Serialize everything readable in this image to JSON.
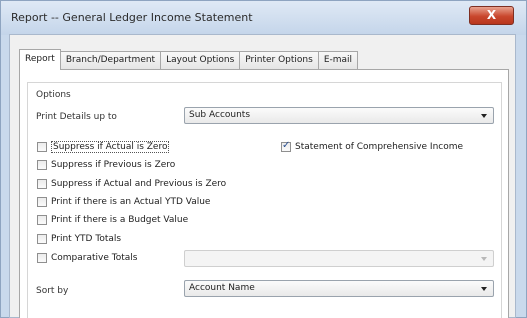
{
  "window": {
    "title": "Report -- General Ledger Income Statement",
    "close_label": "X"
  },
  "tabs": [
    {
      "label": "Report",
      "active": true
    },
    {
      "label": "Branch/Department",
      "active": false
    },
    {
      "label": "Layout Options",
      "active": false
    },
    {
      "label": "Printer Options",
      "active": false
    },
    {
      "label": "E-mail",
      "active": false
    }
  ],
  "options": {
    "group_label": "Options",
    "print_details_label": "Print Details up to",
    "print_details_value": "Sub Accounts",
    "checkboxes": [
      {
        "label": "Suppress if Actual is Zero",
        "checked": false
      },
      {
        "label": "Suppress if Previous is Zero",
        "checked": false
      },
      {
        "label": "Suppress if Actual and Previous is Zero",
        "checked": false
      },
      {
        "label": "Print if there is an Actual YTD Value",
        "checked": false
      },
      {
        "label": "Print if there is a Budget Value",
        "checked": false
      },
      {
        "label": "Print YTD Totals",
        "checked": false
      },
      {
        "label": "Comparative Totals",
        "checked": false
      }
    ],
    "comprehensive": {
      "label": "Statement of Comprehensive Income",
      "checked": true
    },
    "comparative_value": "",
    "sort_by_label": "Sort by",
    "sort_by_value": "Account Name"
  },
  "colors": {
    "titlebar": "#c4d5ea",
    "close_button": "#c9472d",
    "panel_background": "#ffffff"
  },
  "icons": {
    "close": "close-icon",
    "dropdown": "chevron-down-icon",
    "check": "checkmark-icon"
  }
}
